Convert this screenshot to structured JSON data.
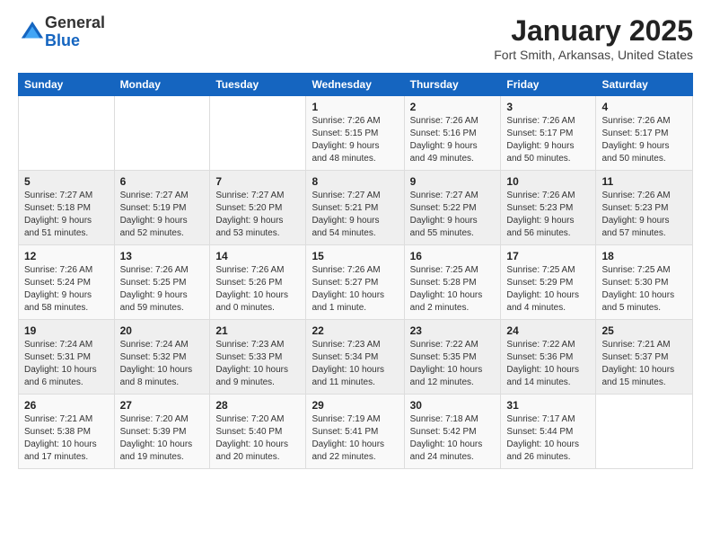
{
  "logo": {
    "general": "General",
    "blue": "Blue"
  },
  "header": {
    "month": "January 2025",
    "location": "Fort Smith, Arkansas, United States"
  },
  "weekdays": [
    "Sunday",
    "Monday",
    "Tuesday",
    "Wednesday",
    "Thursday",
    "Friday",
    "Saturday"
  ],
  "weeks": [
    [
      {
        "day": "",
        "info": ""
      },
      {
        "day": "",
        "info": ""
      },
      {
        "day": "",
        "info": ""
      },
      {
        "day": "1",
        "info": "Sunrise: 7:26 AM\nSunset: 5:15 PM\nDaylight: 9 hours\nand 48 minutes."
      },
      {
        "day": "2",
        "info": "Sunrise: 7:26 AM\nSunset: 5:16 PM\nDaylight: 9 hours\nand 49 minutes."
      },
      {
        "day": "3",
        "info": "Sunrise: 7:26 AM\nSunset: 5:17 PM\nDaylight: 9 hours\nand 50 minutes."
      },
      {
        "day": "4",
        "info": "Sunrise: 7:26 AM\nSunset: 5:17 PM\nDaylight: 9 hours\nand 50 minutes."
      }
    ],
    [
      {
        "day": "5",
        "info": "Sunrise: 7:27 AM\nSunset: 5:18 PM\nDaylight: 9 hours\nand 51 minutes."
      },
      {
        "day": "6",
        "info": "Sunrise: 7:27 AM\nSunset: 5:19 PM\nDaylight: 9 hours\nand 52 minutes."
      },
      {
        "day": "7",
        "info": "Sunrise: 7:27 AM\nSunset: 5:20 PM\nDaylight: 9 hours\nand 53 minutes."
      },
      {
        "day": "8",
        "info": "Sunrise: 7:27 AM\nSunset: 5:21 PM\nDaylight: 9 hours\nand 54 minutes."
      },
      {
        "day": "9",
        "info": "Sunrise: 7:27 AM\nSunset: 5:22 PM\nDaylight: 9 hours\nand 55 minutes."
      },
      {
        "day": "10",
        "info": "Sunrise: 7:26 AM\nSunset: 5:23 PM\nDaylight: 9 hours\nand 56 minutes."
      },
      {
        "day": "11",
        "info": "Sunrise: 7:26 AM\nSunset: 5:23 PM\nDaylight: 9 hours\nand 57 minutes."
      }
    ],
    [
      {
        "day": "12",
        "info": "Sunrise: 7:26 AM\nSunset: 5:24 PM\nDaylight: 9 hours\nand 58 minutes."
      },
      {
        "day": "13",
        "info": "Sunrise: 7:26 AM\nSunset: 5:25 PM\nDaylight: 9 hours\nand 59 minutes."
      },
      {
        "day": "14",
        "info": "Sunrise: 7:26 AM\nSunset: 5:26 PM\nDaylight: 10 hours\nand 0 minutes."
      },
      {
        "day": "15",
        "info": "Sunrise: 7:26 AM\nSunset: 5:27 PM\nDaylight: 10 hours\nand 1 minute."
      },
      {
        "day": "16",
        "info": "Sunrise: 7:25 AM\nSunset: 5:28 PM\nDaylight: 10 hours\nand 2 minutes."
      },
      {
        "day": "17",
        "info": "Sunrise: 7:25 AM\nSunset: 5:29 PM\nDaylight: 10 hours\nand 4 minutes."
      },
      {
        "day": "18",
        "info": "Sunrise: 7:25 AM\nSunset: 5:30 PM\nDaylight: 10 hours\nand 5 minutes."
      }
    ],
    [
      {
        "day": "19",
        "info": "Sunrise: 7:24 AM\nSunset: 5:31 PM\nDaylight: 10 hours\nand 6 minutes."
      },
      {
        "day": "20",
        "info": "Sunrise: 7:24 AM\nSunset: 5:32 PM\nDaylight: 10 hours\nand 8 minutes."
      },
      {
        "day": "21",
        "info": "Sunrise: 7:23 AM\nSunset: 5:33 PM\nDaylight: 10 hours\nand 9 minutes."
      },
      {
        "day": "22",
        "info": "Sunrise: 7:23 AM\nSunset: 5:34 PM\nDaylight: 10 hours\nand 11 minutes."
      },
      {
        "day": "23",
        "info": "Sunrise: 7:22 AM\nSunset: 5:35 PM\nDaylight: 10 hours\nand 12 minutes."
      },
      {
        "day": "24",
        "info": "Sunrise: 7:22 AM\nSunset: 5:36 PM\nDaylight: 10 hours\nand 14 minutes."
      },
      {
        "day": "25",
        "info": "Sunrise: 7:21 AM\nSunset: 5:37 PM\nDaylight: 10 hours\nand 15 minutes."
      }
    ],
    [
      {
        "day": "26",
        "info": "Sunrise: 7:21 AM\nSunset: 5:38 PM\nDaylight: 10 hours\nand 17 minutes."
      },
      {
        "day": "27",
        "info": "Sunrise: 7:20 AM\nSunset: 5:39 PM\nDaylight: 10 hours\nand 19 minutes."
      },
      {
        "day": "28",
        "info": "Sunrise: 7:20 AM\nSunset: 5:40 PM\nDaylight: 10 hours\nand 20 minutes."
      },
      {
        "day": "29",
        "info": "Sunrise: 7:19 AM\nSunset: 5:41 PM\nDaylight: 10 hours\nand 22 minutes."
      },
      {
        "day": "30",
        "info": "Sunrise: 7:18 AM\nSunset: 5:42 PM\nDaylight: 10 hours\nand 24 minutes."
      },
      {
        "day": "31",
        "info": "Sunrise: 7:17 AM\nSunset: 5:44 PM\nDaylight: 10 hours\nand 26 minutes."
      },
      {
        "day": "",
        "info": ""
      }
    ]
  ]
}
